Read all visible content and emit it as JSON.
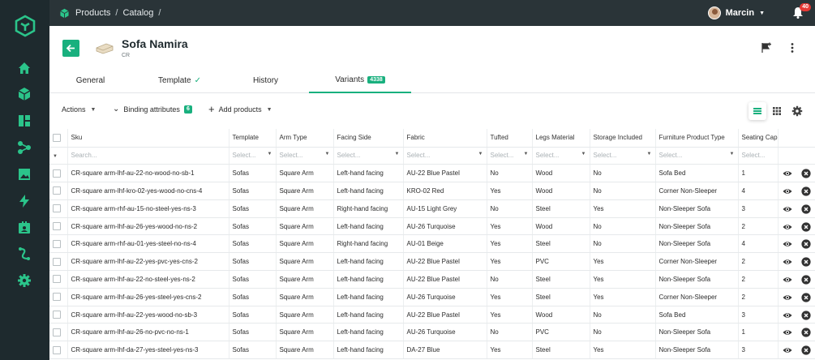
{
  "breadcrumb": {
    "items": [
      "Products",
      "Catalog"
    ],
    "sep": "/"
  },
  "user": {
    "name": "Marcin",
    "notifications": "40"
  },
  "product": {
    "title": "Sofa Namira",
    "code": "CR"
  },
  "tabs": [
    {
      "label": "General"
    },
    {
      "label": "Template",
      "check": "✓"
    },
    {
      "label": "History"
    },
    {
      "label": "Variants",
      "badge": "4338"
    }
  ],
  "toolbar": {
    "actions": "Actions",
    "binding": "Binding attributes",
    "binding_count": "6",
    "add": "Add products"
  },
  "columns": [
    "Sku",
    "Template",
    "Arm Type",
    "Facing Side",
    "Fabric",
    "Tufted",
    "Legs Material",
    "Storage Included",
    "Furniture Product Type",
    "Seating Cap"
  ],
  "filters": {
    "search": "Search...",
    "select": "Select..."
  },
  "rows": [
    [
      "CR-square arm-lhf-au-22-no-wood-no-sb-1",
      "Sofas",
      "Square Arm",
      "Left-hand facing",
      "AU-22 Blue Pastel",
      "No",
      "Wood",
      "No",
      "Sofa Bed",
      "1"
    ],
    [
      "CR-square arm-lhf-kro-02-yes-wood-no-cns-4",
      "Sofas",
      "Square Arm",
      "Left-hand facing",
      "KRO-02 Red",
      "Yes",
      "Wood",
      "No",
      "Corner Non-Sleeper",
      "4"
    ],
    [
      "CR-square arm-rhf-au-15-no-steel-yes-ns-3",
      "Sofas",
      "Square Arm",
      "Right-hand facing",
      "AU-15 Light Grey",
      "No",
      "Steel",
      "Yes",
      "Non-Sleeper Sofa",
      "3"
    ],
    [
      "CR-square arm-lhf-au-26-yes-wood-no-ns-2",
      "Sofas",
      "Square Arm",
      "Left-hand facing",
      "AU-26 Turquoise",
      "Yes",
      "Wood",
      "No",
      "Non-Sleeper Sofa",
      "2"
    ],
    [
      "CR-square arm-rhf-au-01-yes-steel-no-ns-4",
      "Sofas",
      "Square Arm",
      "Right-hand facing",
      "AU-01 Beige",
      "Yes",
      "Steel",
      "No",
      "Non-Sleeper Sofa",
      "4"
    ],
    [
      "CR-square arm-lhf-au-22-yes-pvc-yes-cns-2",
      "Sofas",
      "Square Arm",
      "Left-hand facing",
      "AU-22 Blue Pastel",
      "Yes",
      "PVC",
      "Yes",
      "Corner Non-Sleeper",
      "2"
    ],
    [
      "CR-square arm-lhf-au-22-no-steel-yes-ns-2",
      "Sofas",
      "Square Arm",
      "Left-hand facing",
      "AU-22 Blue Pastel",
      "No",
      "Steel",
      "Yes",
      "Non-Sleeper Sofa",
      "2"
    ],
    [
      "CR-square arm-lhf-au-26-yes-steel-yes-cns-2",
      "Sofas",
      "Square Arm",
      "Left-hand facing",
      "AU-26 Turquoise",
      "Yes",
      "Steel",
      "Yes",
      "Corner Non-Sleeper",
      "2"
    ],
    [
      "CR-square arm-lhf-au-22-yes-wood-no-sb-3",
      "Sofas",
      "Square Arm",
      "Left-hand facing",
      "AU-22 Blue Pastel",
      "Yes",
      "Wood",
      "No",
      "Sofa Bed",
      "3"
    ],
    [
      "CR-square arm-lhf-au-26-no-pvc-no-ns-1",
      "Sofas",
      "Square Arm",
      "Left-hand facing",
      "AU-26 Turquoise",
      "No",
      "PVC",
      "No",
      "Non-Sleeper Sofa",
      "1"
    ],
    [
      "CR-square arm-lhf-da-27-yes-steel-yes-ns-3",
      "Sofas",
      "Square Arm",
      "Left-hand facing",
      "DA-27 Blue",
      "Yes",
      "Steel",
      "Yes",
      "Non-Sleeper Sofa",
      "3"
    ]
  ],
  "colors": {
    "accent": "#19b07e",
    "sidebar": "#1e2a2e",
    "topbar": "#2a3438",
    "icon": "#2bc48a"
  },
  "icons": [
    "logo-cube-icon",
    "home-icon",
    "cube-icon",
    "dashboard-icon",
    "share-nodes-icon",
    "image-icon",
    "lightning-icon",
    "contact-card-icon",
    "routes-icon",
    "gear-icon",
    "bell-icon",
    "eye-icon",
    "close-circle-icon"
  ]
}
